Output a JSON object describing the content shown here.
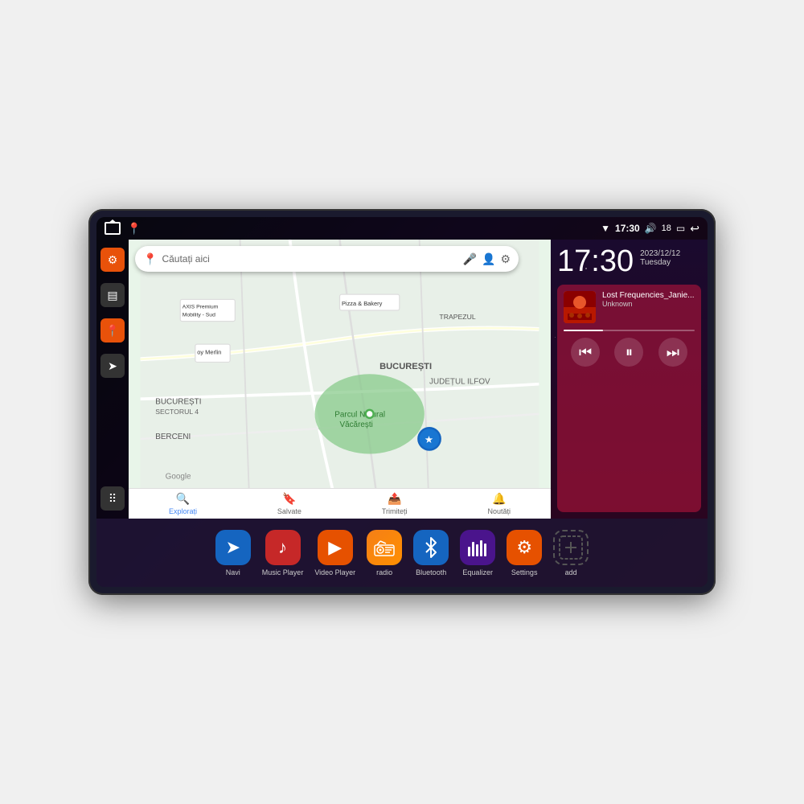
{
  "device": {
    "status_bar": {
      "wifi_icon": "▼",
      "time": "17:30",
      "volume_icon": "🔊",
      "battery_level": "18",
      "battery_icon": "▭",
      "back_icon": "↩"
    },
    "clock": {
      "time": "17:30",
      "date": "2023/12/12",
      "day": "Tuesday"
    },
    "music": {
      "track_name": "Lost Frequencies_Janie...",
      "artist": "Unknown",
      "album_emoji": "🎵"
    },
    "map": {
      "search_placeholder": "Căutați aici",
      "bottom_items": [
        {
          "label": "Explorați",
          "icon": "🔍",
          "active": true
        },
        {
          "label": "Salvate",
          "icon": "🔖",
          "active": false
        },
        {
          "label": "Trimiteți",
          "icon": "📤",
          "active": false
        },
        {
          "label": "Noutăți",
          "icon": "🔔",
          "active": false
        }
      ]
    },
    "apps": [
      {
        "id": "navi",
        "label": "Navi",
        "icon": "➤",
        "color": "#1565C0"
      },
      {
        "id": "music-player",
        "label": "Music Player",
        "icon": "♪",
        "color": "#c62828"
      },
      {
        "id": "video-player",
        "label": "Video Player",
        "icon": "▶",
        "color": "#e65100"
      },
      {
        "id": "radio",
        "label": "radio",
        "icon": "📻",
        "color": "#f57f17"
      },
      {
        "id": "bluetooth",
        "label": "Bluetooth",
        "icon": "⚡",
        "color": "#1565C0"
      },
      {
        "id": "equalizer",
        "label": "Equalizer",
        "icon": "≡",
        "color": "#4a148c"
      },
      {
        "id": "settings",
        "label": "Settings",
        "icon": "⚙",
        "color": "#e65100"
      },
      {
        "id": "add",
        "label": "add",
        "icon": "+",
        "color": "transparent"
      }
    ],
    "sidebar": {
      "items": [
        {
          "id": "settings",
          "icon": "⚙",
          "color": "#e8520a"
        },
        {
          "id": "archive",
          "icon": "▤",
          "color": "#333"
        },
        {
          "id": "map",
          "icon": "📍",
          "color": "#e8520a"
        },
        {
          "id": "nav",
          "icon": "➤",
          "color": "#333"
        }
      ],
      "grid_icon": "⠿"
    }
  }
}
